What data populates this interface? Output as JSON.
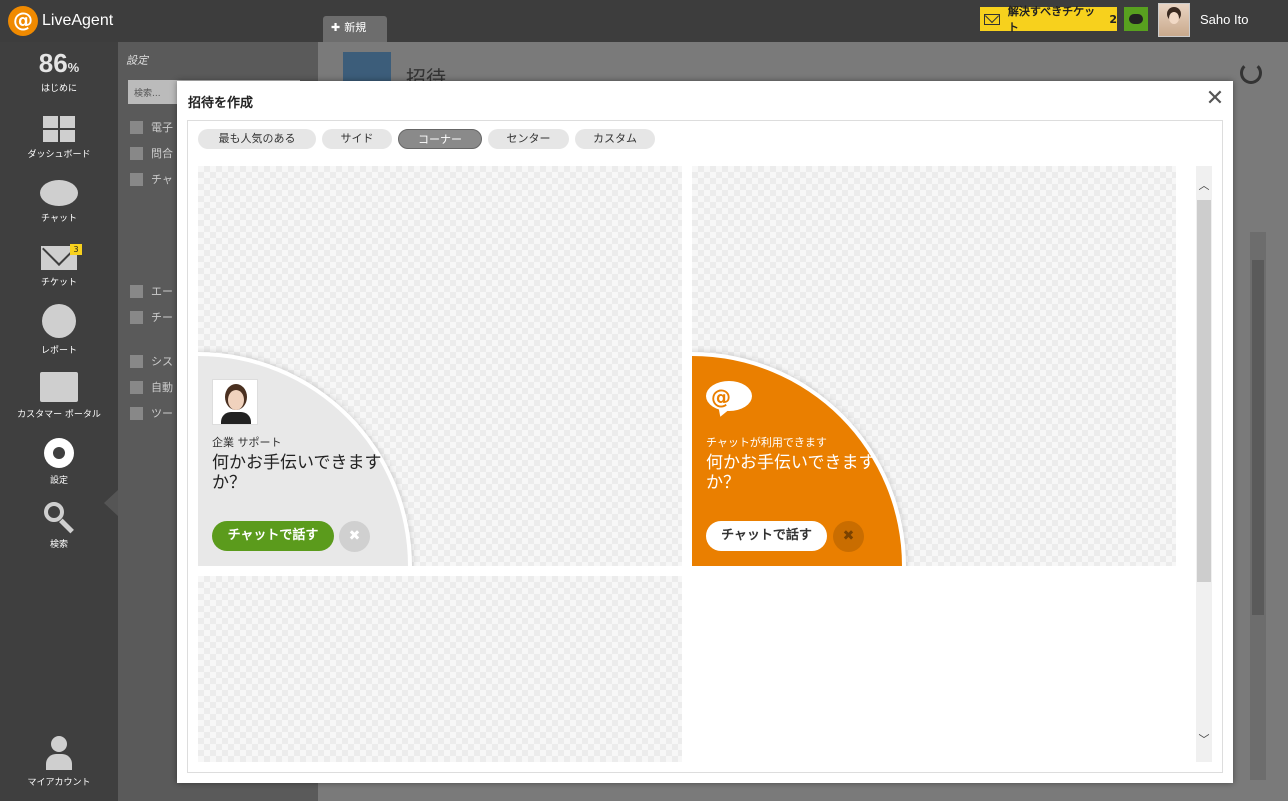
{
  "app": {
    "logo_text": "LiveAgent",
    "new_tab_label": "新規",
    "ticket_alert_label": "解決すべきチケット",
    "ticket_alert_count": "2",
    "user_name": "Saho Ito"
  },
  "leftnav": {
    "progress_value": "86",
    "progress_unit": "%",
    "progress_label": "はじめに",
    "dashboard": "ダッシュボード",
    "chat": "チャット",
    "tickets": "チケット",
    "tickets_badge": "3",
    "reports": "レポート",
    "customer_portal": "カスタマー ポータル",
    "settings": "設定",
    "search": "検索",
    "my_account": "マイアカウント"
  },
  "settings_panel": {
    "title": "設定",
    "search_placeholder": "検索...",
    "rows": [
      "電子",
      "問合",
      "チャ",
      "",
      "",
      "",
      "エー",
      "チー",
      "シス",
      "自動",
      "ツー"
    ]
  },
  "main": {
    "title": "招待"
  },
  "modal": {
    "title": "招待を作成",
    "close_symbol": "✕",
    "tabs": [
      {
        "label": "最も人気のある",
        "active": false
      },
      {
        "label": "サイド",
        "active": false
      },
      {
        "label": "コーナー",
        "active": true
      },
      {
        "label": "センター",
        "active": false
      },
      {
        "label": "カスタム",
        "active": false
      }
    ],
    "templates": [
      {
        "style": "grey",
        "subtitle": "企業 サポート",
        "headline": "何かお手伝いできますか？",
        "button_label": "チャットで話す",
        "close_symbol": "✖"
      },
      {
        "style": "orange",
        "subtitle": "チャットが利用できます",
        "headline": "何かお手伝いできますか？",
        "button_label": "チャットで話す",
        "close_symbol": "✖"
      }
    ],
    "scroll_up_symbol": "︿",
    "scroll_down_symbol": "﹀"
  },
  "colors": {
    "accent_orange": "#ea7f00",
    "chat_green": "#5b9b1c",
    "alert_yellow": "#f7d11d"
  }
}
